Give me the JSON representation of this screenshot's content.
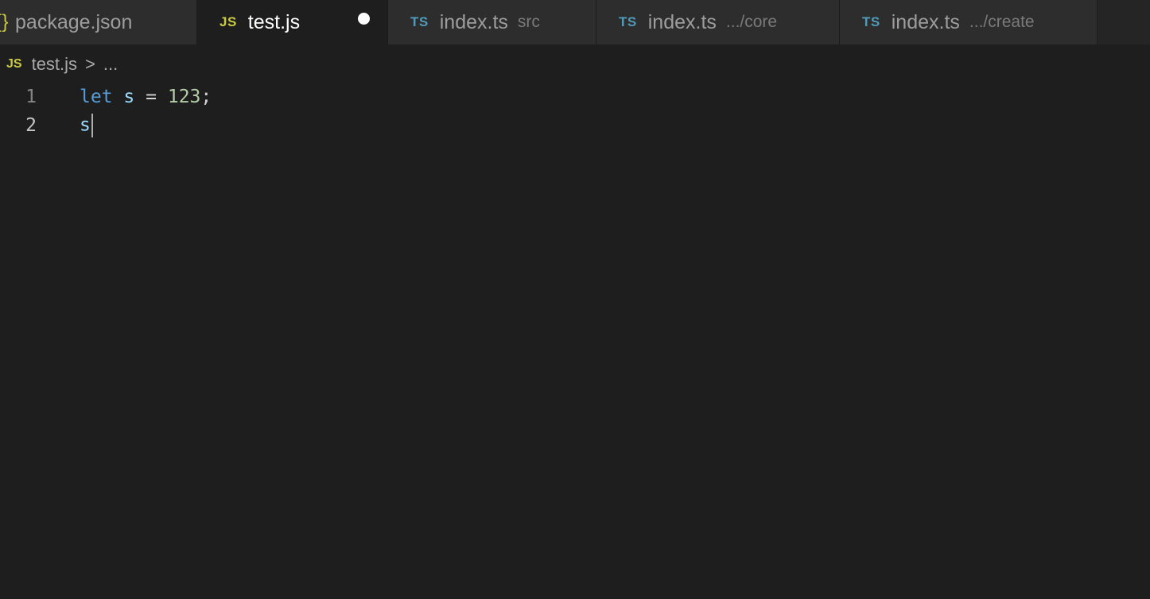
{
  "tabs": [
    {
      "icon": "{}",
      "icon_name": "json-icon",
      "label": "package.json",
      "desc": ""
    },
    {
      "icon": "JS",
      "icon_name": "js-icon",
      "label": "test.js",
      "desc": "",
      "active": true,
      "modified": true
    },
    {
      "icon": "TS",
      "icon_name": "ts-icon",
      "label": "index.ts",
      "desc": "src"
    },
    {
      "icon": "TS",
      "icon_name": "ts-icon",
      "label": "index.ts",
      "desc": ".../core"
    },
    {
      "icon": "TS",
      "icon_name": "ts-icon",
      "label": "index.ts",
      "desc": ".../create"
    }
  ],
  "breadcrumb": {
    "icon": "JS",
    "file": "test.js",
    "separator": ">",
    "more": "..."
  },
  "editor": {
    "lines": [
      {
        "number": "1",
        "tokens": {
          "kw": "let",
          "var": "s",
          "op": "=",
          "num": "123",
          "end": ";"
        }
      },
      {
        "number": "2",
        "tokens": {
          "var": "s"
        }
      }
    ]
  },
  "colors": {
    "js_icon": "#cbcb41",
    "ts_icon": "#519aba",
    "keyword": "#569cd6",
    "variable": "#9cdcfe",
    "number": "#b5cea8"
  }
}
